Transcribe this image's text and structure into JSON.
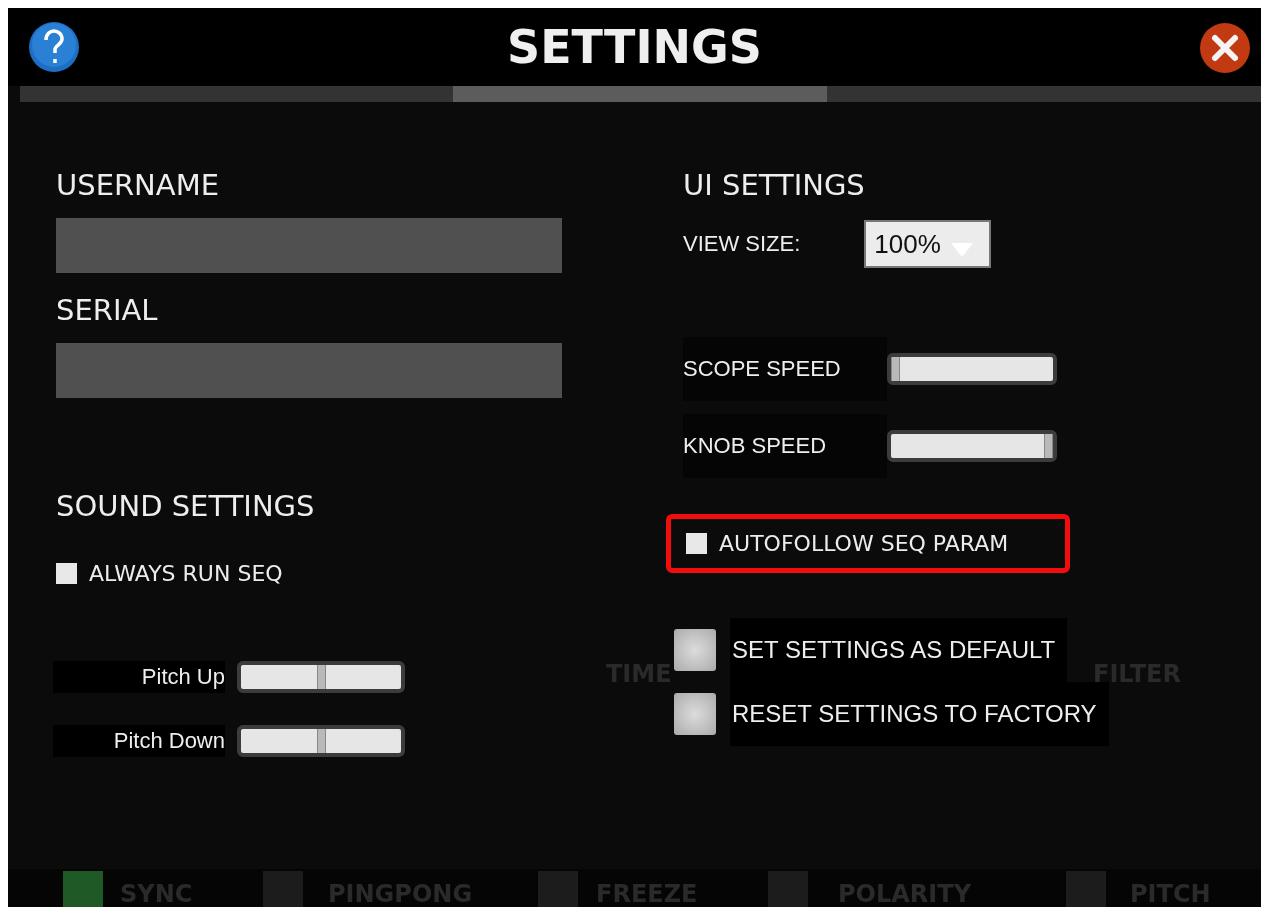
{
  "header": {
    "title": "SETTINGS"
  },
  "page_indicator": [
    {
      "selected": false
    },
    {
      "selected": true
    },
    {
      "selected": false
    }
  ],
  "account": {
    "username": {
      "label": "USERNAME"
    },
    "serial": {
      "label": "SERIAL"
    }
  },
  "sound_settings": {
    "heading": "SOUND SETTINGS",
    "options": [
      {
        "label": "ALWAYS RUN SEQ",
        "checked": false
      }
    ],
    "sliders": [
      {
        "label": "Pitch Up",
        "level": 0.5
      },
      {
        "label": "Pitch Down",
        "level": 0.5
      }
    ]
  },
  "ui_settings": {
    "heading": "UI SETTINGS",
    "view_size": {
      "label": "VIEW SIZE:",
      "value": "100%"
    },
    "sliders": [
      {
        "label": "SCOPE SPEED",
        "level": 0
      },
      {
        "label": "KNOB SPEED",
        "level": 1
      }
    ],
    "options": [
      {
        "label": "AUTOFOLLOW SEQ PARAM",
        "checked": false,
        "highlighted": true
      }
    ]
  },
  "actions": [
    {
      "label": "SET SETTINGS AS DEFAULT"
    },
    {
      "label": "RESET SETTINGS TO FACTORY"
    }
  ],
  "background": {
    "sections": [
      "TIME",
      "FILTER"
    ],
    "toggles": [
      {
        "label": "SYNC",
        "on": true
      },
      {
        "label": "PINGPONG",
        "on": false
      },
      {
        "label": "FREEZE",
        "on": false
      },
      {
        "label": "POLARITY",
        "on": false
      },
      {
        "label": "PITCH",
        "on": false
      }
    ]
  }
}
